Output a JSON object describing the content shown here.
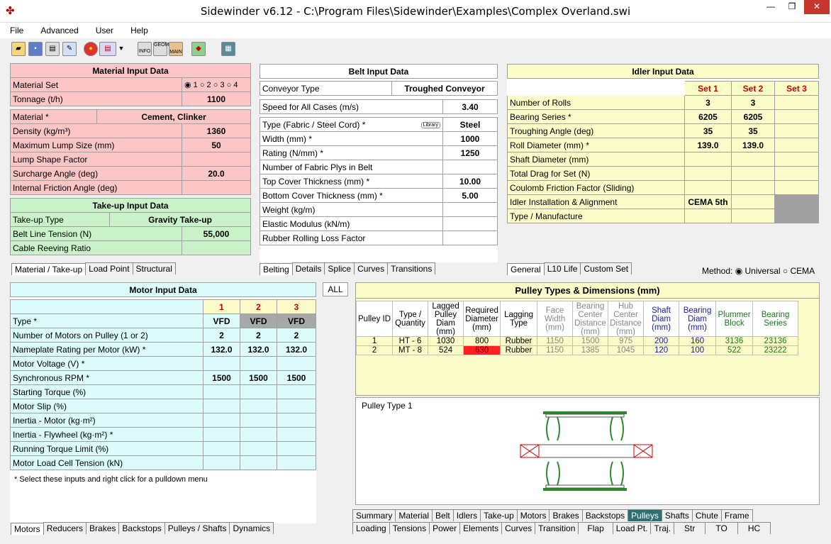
{
  "title": "Sidewinder v6.12 - C:\\Program Files\\Sidewinder\\Examples\\Complex Overland.swi",
  "window_buttons": {
    "minimize": "—",
    "maximize": "❐",
    "close": "✕"
  },
  "menu": [
    "File",
    "Advanced",
    "User",
    "Help"
  ],
  "material": {
    "title": "Material Input Data",
    "set_label": "Material Set",
    "sets": [
      "1",
      "2",
      "3",
      "4"
    ],
    "rows": [
      {
        "label": "Tonnage (t/h)",
        "value": "1100"
      },
      {
        "label": "Material *",
        "value": "Cement, Clinker"
      },
      {
        "label": "Density (kg/m³)",
        "value": "1360"
      },
      {
        "label": "Maximum Lump Size (mm)",
        "value": "50"
      },
      {
        "label": "Lump Shape Factor",
        "value": ""
      },
      {
        "label": "Surcharge Angle (deg)",
        "value": "20.0"
      },
      {
        "label": "Internal Friction Angle (deg)",
        "value": ""
      }
    ]
  },
  "takeup": {
    "title": "Take-up Input Data",
    "rows": [
      {
        "label": "Take-up Type",
        "value": "Gravity Take-up"
      },
      {
        "label": "Belt Line Tension (N)",
        "value": "55,000"
      },
      {
        "label": "Cable Reeving Ratio",
        "value": ""
      }
    ]
  },
  "tabs_left_top": [
    "Material / Take-up",
    "Load Point",
    "Structural"
  ],
  "belt": {
    "title": "Belt Input Data",
    "rows": [
      {
        "label": "Conveyor Type",
        "value": "Troughed Conveyor"
      },
      {
        "label": "Speed for All Cases (m/s)",
        "value": "3.40"
      },
      {
        "label": "Type (Fabric / Steel Cord) *",
        "value": "Steel",
        "tag": "Library"
      },
      {
        "label": "Width (mm) *",
        "value": "1000"
      },
      {
        "label": "Rating (N/mm) *",
        "value": "1250"
      },
      {
        "label": "Number of Fabric Plys in Belt",
        "value": ""
      },
      {
        "label": "Top Cover Thickness (mm) *",
        "value": "10.00"
      },
      {
        "label": "Bottom Cover Thickness (mm) *",
        "value": "5.00"
      },
      {
        "label": "Weight (kg/m)",
        "value": ""
      },
      {
        "label": "Elastic Modulus (kN/m)",
        "value": ""
      },
      {
        "label": "Rubber Rolling Loss Factor",
        "value": ""
      }
    ]
  },
  "tabs_belt": [
    "Belting",
    "Details",
    "Splice",
    "Curves",
    "Transitions"
  ],
  "idler": {
    "title": "Idler Input Data",
    "sets": [
      "Set 1",
      "Set 2",
      "Set 3"
    ],
    "rows": [
      {
        "label": "Number of Rolls",
        "v": [
          "3",
          "3",
          ""
        ]
      },
      {
        "label": "Bearing Series *",
        "v": [
          "6205",
          "6205",
          ""
        ]
      },
      {
        "label": "Troughing Angle (deg)",
        "v": [
          "35",
          "35",
          ""
        ]
      },
      {
        "label": "Roll Diameter (mm) *",
        "v": [
          "139.0",
          "139.0",
          ""
        ]
      },
      {
        "label": "Shaft Diameter (mm)",
        "v": [
          "",
          "",
          ""
        ]
      },
      {
        "label": "Total Drag for Set (N)",
        "v": [
          "",
          "",
          ""
        ]
      },
      {
        "label": "Coulomb Friction Factor (Sliding)",
        "v": [
          "",
          "",
          ""
        ]
      },
      {
        "label": "Idler Installation & Alignment",
        "v": [
          "CEMA 5th",
          "",
          ""
        ]
      },
      {
        "label": "Type / Manufacture",
        "v": [
          "",
          "",
          ""
        ]
      }
    ]
  },
  "tabs_idler": [
    "General",
    "L10 Life",
    "Custom Set"
  ],
  "method": {
    "label": "Method:",
    "options": [
      "Universal",
      "CEMA"
    ]
  },
  "motor": {
    "title": "Motor Input Data",
    "cols": [
      "1",
      "2",
      "3"
    ],
    "rows": [
      {
        "label": "Type *",
        "v": [
          "VFD",
          "VFD",
          "VFD"
        ]
      },
      {
        "label": "Number of Motors on Pulley (1 or 2)",
        "v": [
          "2",
          "2",
          "2"
        ]
      },
      {
        "label": "Nameplate Rating per Motor (kW) *",
        "v": [
          "132.0",
          "132.0",
          "132.0"
        ]
      },
      {
        "label": "Motor Voltage (V) *",
        "v": [
          "",
          "",
          ""
        ]
      },
      {
        "label": "Synchronous RPM *",
        "v": [
          "1500",
          "1500",
          "1500"
        ]
      },
      {
        "label": "Starting Torque (%)",
        "v": [
          "",
          "",
          ""
        ]
      },
      {
        "label": "Motor Slip (%)",
        "v": [
          "",
          "",
          ""
        ]
      },
      {
        "label": "Inertia - Motor (kg·m²)",
        "v": [
          "",
          "",
          ""
        ]
      },
      {
        "label": "Inertia - Flywheel (kg·m²) *",
        "v": [
          "",
          "",
          ""
        ]
      },
      {
        "label": "Running Torque Limit (%)",
        "v": [
          "",
          "",
          ""
        ]
      },
      {
        "label": "Motor Load Cell Tension (kN)",
        "v": [
          "",
          "",
          ""
        ]
      }
    ],
    "note": "* Select these inputs and right click for a pulldown menu"
  },
  "tabs_motor": [
    "Motors",
    "Reducers",
    "Brakes",
    "Backstops",
    "Pulleys / Shafts",
    "Dynamics"
  ],
  "all_tab": "ALL",
  "pulley": {
    "title": "Pulley Types & Dimensions (mm)",
    "headers": [
      "Pulley ID",
      "Type / Quantity",
      "Lagged Pulley Diam (mm)",
      "Required Diameter (mm)",
      "Lagging Type",
      "Face Width (mm)",
      "Bearing Center Distance (mm)",
      "Hub Center Distance (mm)",
      "Shaft Diam (mm)",
      "Bearing Diam (mm)",
      "Plummer Block",
      "Bearing Series"
    ],
    "rows": [
      [
        "1",
        "HT - 6",
        "1030",
        "800",
        "Rubber",
        "1150",
        "1500",
        "975",
        "200",
        "160",
        "3136",
        "23136"
      ],
      [
        "2",
        "MT - 8",
        "524",
        "630",
        "Rubber",
        "1150",
        "1385",
        "1045",
        "120",
        "100",
        "522",
        "23222"
      ]
    ],
    "drawing_label": "Pulley Type 1"
  },
  "bottom_tabs_1": [
    "Summary",
    "Material",
    "Belt",
    "Idlers",
    "Take-up",
    "Motors",
    "Brakes",
    "Backstops",
    "Pulleys",
    "Shafts",
    "Chute",
    "Frame"
  ],
  "bottom_tabs_2": [
    "Loading",
    "Tensions",
    "Power",
    "Elements",
    "Curves",
    "Transition",
    "Flap",
    "Load Pt.",
    "Traj.",
    "Str",
    "TO",
    "HC"
  ],
  "toolbar_icons": [
    "open-icon",
    "save-icon",
    "print-icon",
    "edit-icon",
    "globe-icon",
    "flag-icon",
    "info-icon",
    "geom-icon",
    "main-icon",
    "palette-icon",
    "calculator-icon"
  ],
  "toolbar_text": {
    "info": "INFO",
    "geom": "GEOM",
    "main": "MAIN"
  },
  "colors": {
    "material": "#fdc6c6",
    "takeup": "#c9f2c9",
    "motor": "#dcfcfc",
    "idler": "#fcfcc8",
    "motor_col_head": "#fcfcc8",
    "highlight": "#ff2020"
  }
}
